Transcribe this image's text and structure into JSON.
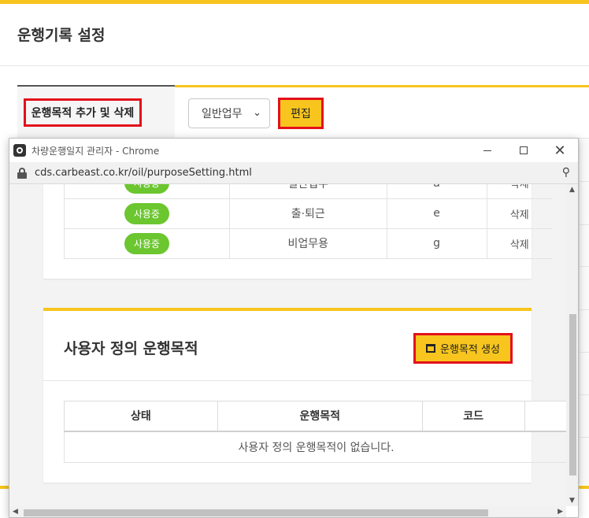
{
  "page": {
    "title": "운행기록 설정",
    "section_label": "운행목적 추가 및 삭제",
    "select_value": "일반업무",
    "edit_button": "편집"
  },
  "popup": {
    "title": "차량운행일지 관리자 - Chrome",
    "url": "cds.carbeast.co.kr/oil/purposeSetting.html",
    "system_rows": [
      {
        "status": "사용중",
        "purpose": "일반업무",
        "code": "a",
        "action": "삭제"
      },
      {
        "status": "사용중",
        "purpose": "출·퇴근",
        "code": "e",
        "action": "삭제"
      },
      {
        "status": "사용중",
        "purpose": "비업무용",
        "code": "g",
        "action": "삭제"
      }
    ],
    "custom_section": {
      "heading": "사용자 정의 운행목적",
      "create_button": "운행목적 생성",
      "columns": [
        "상태",
        "운행목적",
        "코드"
      ],
      "empty_message": "사용자 정의 운행목적이 없습니다."
    }
  },
  "colors": {
    "accent": "#f7c51e",
    "highlight_border": "#e3101a",
    "status_green": "#6cc62f"
  }
}
